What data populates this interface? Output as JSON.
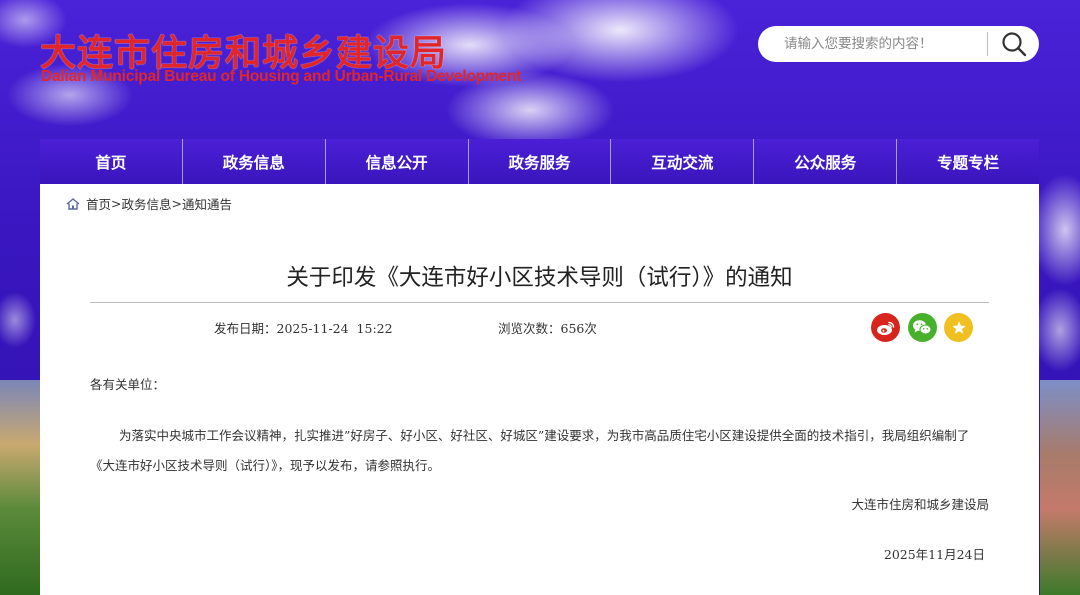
{
  "header": {
    "logo_cn": "大连市住房和城乡建设局",
    "logo_en": "Dalian Municipal Bureau of Housing and Urban-Rural Development",
    "search_placeholder": "请输入您要搜索的内容！",
    "search_icon": "search-icon",
    "brand_color": "#e0262a"
  },
  "nav": {
    "items": [
      "首页",
      "政务信息",
      "信息公开",
      "政务服务",
      "互动交流",
      "公众服务",
      "专题专栏"
    ],
    "color": "#3a15bc"
  },
  "breadcrumb": {
    "icon": "home-icon",
    "items": [
      "首页",
      "政务信息",
      "通知通告"
    ],
    "separator": ">"
  },
  "article": {
    "title": "关于印发《大连市好小区技术导则（试行）》的通知",
    "publish_label": "发布日期：",
    "publish_value": "2025-11-24  15:22",
    "views_label": "浏览次数：",
    "views_value": "656次",
    "share": [
      {
        "name": "weibo-icon",
        "color": "#d7251d"
      },
      {
        "name": "wechat-icon",
        "color": "#48b12b"
      },
      {
        "name": "favorite-icon",
        "color": "#f0c020"
      }
    ],
    "salutation": "各有关单位：",
    "paragraph": "为落实中央城市工作会议精神，扎实推进”好房子、好小区、好社区、好城区”建设要求，为我市高品质住宅小区建设提供全面的技术指引，我局组织编制了《大连市好小区技术导则（试行）》，现予以发布，请参照执行。",
    "signature": "大连市住房和城乡建设局",
    "sign_date": "2025年11月24日"
  }
}
